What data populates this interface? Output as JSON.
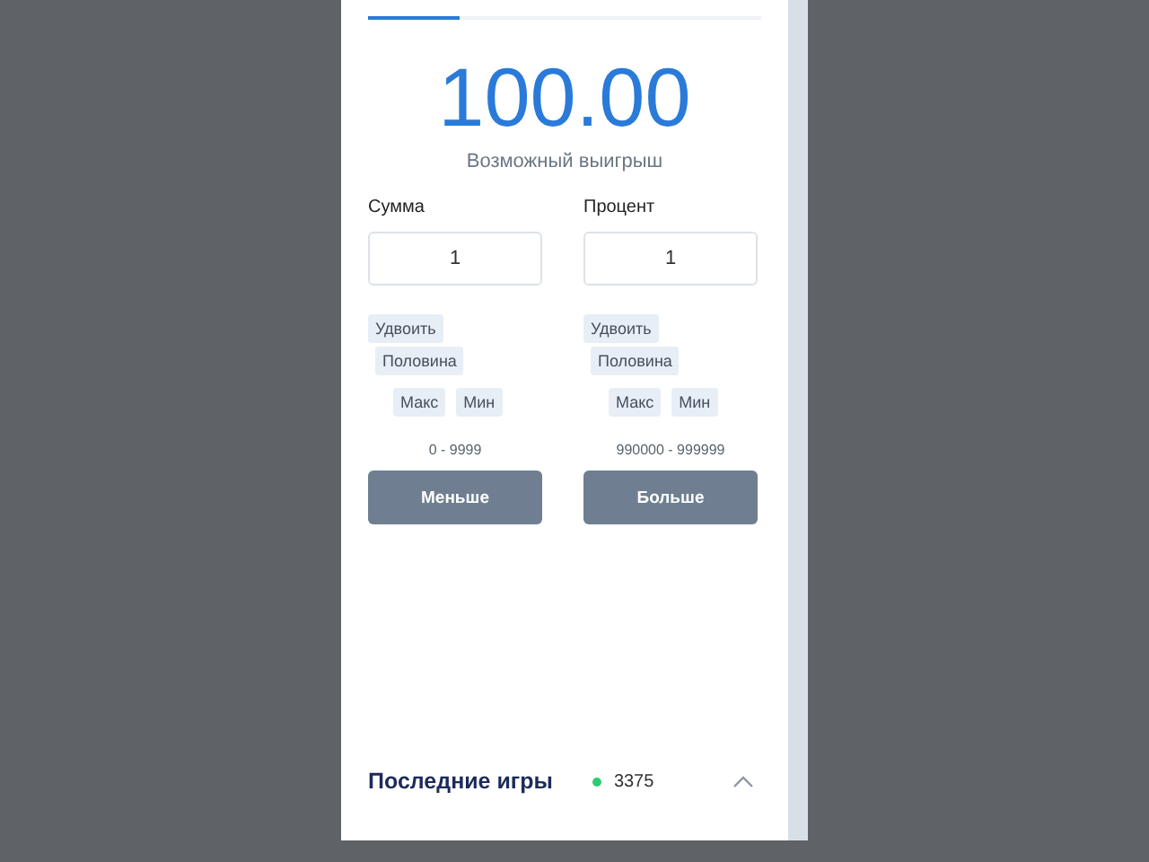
{
  "win_amount": "100.00",
  "win_label": "Возможный выигрыш",
  "columns": [
    {
      "label": "Сумма",
      "value": "1",
      "chips": [
        "Удвоить",
        "Половина",
        "Макс",
        "Мин"
      ],
      "range": "0 - 9999",
      "button": "Меньше"
    },
    {
      "label": "Процент",
      "value": "1",
      "chips": [
        "Удвоить",
        "Половина",
        "Макс",
        "Мин"
      ],
      "range": "990000 - 999999",
      "button": "Больше"
    }
  ],
  "recent_games": {
    "title": "Последние игры",
    "count": "3375"
  }
}
